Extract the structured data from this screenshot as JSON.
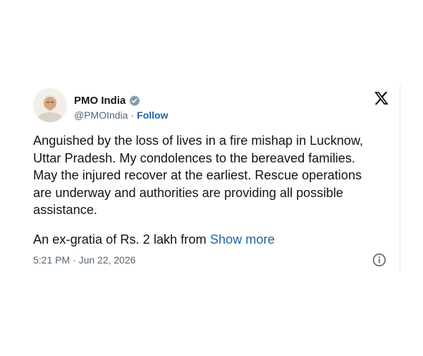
{
  "author": {
    "display_name": "PMO India",
    "handle": "@PMOIndia",
    "separator": "·",
    "follow_label": "Follow",
    "verified": true
  },
  "tweet": {
    "text": "Anguished by the loss of lives in a fire mishap in Lucknow, Uttar Pradesh. My condolences to the bereaved families. May the injured recover at the earliest. Rescue operations are underway and authorities are providing all possible assistance.",
    "text_lines": [
      "Anguished by the loss of lives in a fire mishap in Lucknow,",
      "Uttar Pradesh. My condolences to the bereaved families.",
      "May the injured recover at the earliest. Rescue operations",
      "are underway and authorities are providing all possible",
      "assistance."
    ],
    "truncated_text": "An ex-gratia of Rs. 2 lakh from",
    "show_more_label": "Show more",
    "timestamp": "5:21 PM · Jun 22, 2026"
  },
  "icons": {
    "brand": "x-logo-icon",
    "verified": "verified-badge-icon",
    "info": "info-icon",
    "avatar": "avatar"
  },
  "colors": {
    "text_primary": "#0f1419",
    "text_secondary": "#536471",
    "link": "#1d65a8",
    "verified_badge": "#829aab"
  }
}
